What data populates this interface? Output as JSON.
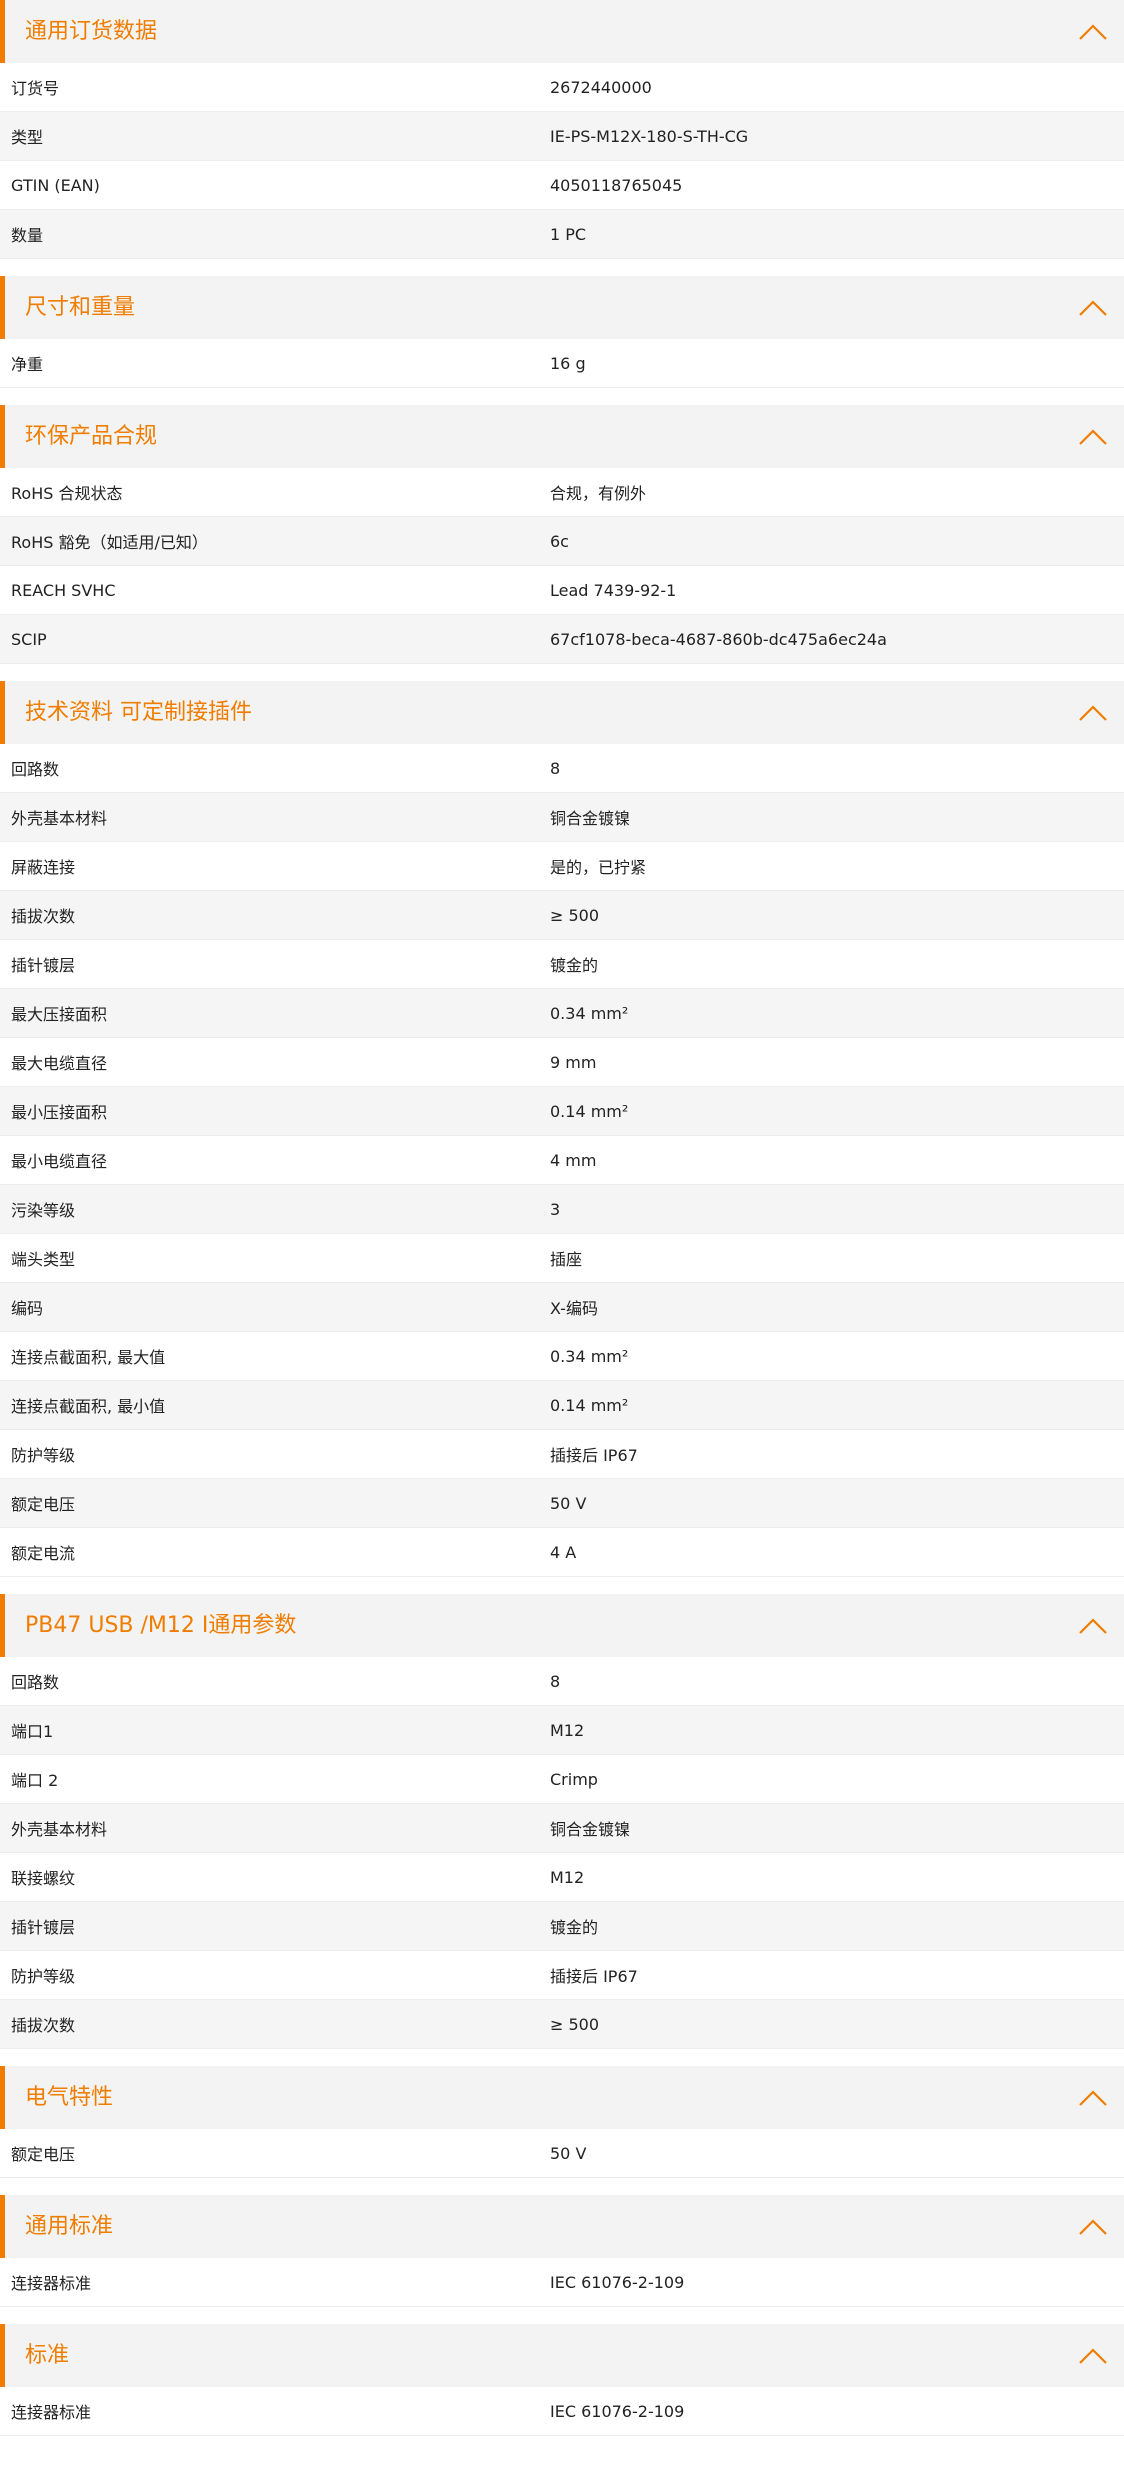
{
  "colors": {
    "accent": "#f07d00",
    "header_bg": "#f3f3f3",
    "alt_row_bg": "#f5f5f5"
  },
  "icons": {
    "collapse": "chevron-up-icon"
  },
  "sections": [
    {
      "title": "通用订货数据",
      "rows": [
        {
          "label": "订货号",
          "value": "2672440000"
        },
        {
          "label": "类型",
          "value": "IE-PS-M12X-180-S-TH-CG"
        },
        {
          "label": "GTIN (EAN)",
          "value": "4050118765045"
        },
        {
          "label": "数量",
          "value": "1  PC"
        }
      ]
    },
    {
      "title": "尺寸和重量",
      "rows": [
        {
          "label": "净重",
          "value": "16  g"
        }
      ]
    },
    {
      "title": "环保产品合规",
      "rows": [
        {
          "label": "RoHS 合规状态",
          "value": "合规，有例外"
        },
        {
          "label": "RoHS 豁免（如适用/已知）",
          "value": "6c"
        },
        {
          "label": "REACH SVHC",
          "value": "Lead 7439-92-1"
        },
        {
          "label": "SCIP",
          "value": "67cf1078-beca-4687-860b-dc475a6ec24a"
        }
      ]
    },
    {
      "title": "技术资料 可定制接插件",
      "rows": [
        {
          "label": "回路数",
          "value": "8"
        },
        {
          "label": "外壳基本材料",
          "value": "铜合金镀镍"
        },
        {
          "label": "屏蔽连接",
          "value": "是的，已拧紧"
        },
        {
          "label": "插拔次数",
          "value": "≥ 500"
        },
        {
          "label": "插针镀层",
          "value": "镀金的"
        },
        {
          "label": "最大压接面积",
          "value": "0.34  mm²"
        },
        {
          "label": "最大电缆直径",
          "value": "9  mm"
        },
        {
          "label": "最小压接面积",
          "value": "0.14  mm²"
        },
        {
          "label": "最小电缆直径",
          "value": "4  mm"
        },
        {
          "label": "污染等级",
          "value": "3"
        },
        {
          "label": "端头类型",
          "value": "插座"
        },
        {
          "label": "编码",
          "value": "X-编码"
        },
        {
          "label": "连接点截面积, 最大值",
          "value": "0.34  mm²"
        },
        {
          "label": "连接点截面积, 最小值",
          "value": "0.14  mm²"
        },
        {
          "label": "防护等级",
          "value": "插接后 IP67"
        },
        {
          "label": "额定电压",
          "value": "50  V"
        },
        {
          "label": "额定电流",
          "value": "4  A"
        }
      ]
    },
    {
      "title": "PB47 USB /M12 I通用参数",
      "rows": [
        {
          "label": "回路数",
          "value": "8"
        },
        {
          "label": "端口1",
          "value": "M12"
        },
        {
          "label": "端口 2",
          "value": "Crimp"
        },
        {
          "label": "外壳基本材料",
          "value": "铜合金镀镍"
        },
        {
          "label": "联接螺纹",
          "value": "M12"
        },
        {
          "label": "插针镀层",
          "value": "镀金的"
        },
        {
          "label": "防护等级",
          "value": "插接后 IP67"
        },
        {
          "label": "插拔次数",
          "value": "≥ 500"
        }
      ]
    },
    {
      "title": "电气特性",
      "rows": [
        {
          "label": "额定电压",
          "value": "50  V"
        }
      ]
    },
    {
      "title": "通用标准",
      "rows": [
        {
          "label": "连接器标准",
          "value": "IEC 61076-2-109"
        }
      ]
    },
    {
      "title": "标准",
      "rows": [
        {
          "label": "连接器标准",
          "value": "IEC 61076-2-109"
        }
      ]
    }
  ]
}
